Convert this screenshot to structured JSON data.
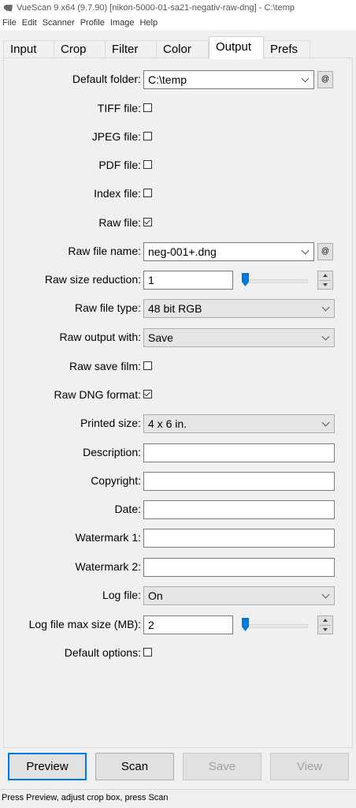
{
  "window": {
    "title": "VueScan 9 x64 (9.7.90) [nikon-5000-01-sa21-negativ-raw-dng] - C:\\temp"
  },
  "menu": [
    "File",
    "Edit",
    "Scanner",
    "Profile",
    "Image",
    "Help"
  ],
  "tabs": [
    {
      "label": "Input",
      "active": false
    },
    {
      "label": "Crop",
      "active": false
    },
    {
      "label": "Filter",
      "active": false
    },
    {
      "label": "Color",
      "active": false
    },
    {
      "label": "Output",
      "active": true
    },
    {
      "label": "Prefs",
      "active": false
    }
  ],
  "output": {
    "default_folder": {
      "label": "Default folder:",
      "value": "C:\\temp",
      "at": "@"
    },
    "tiff_file": {
      "label": "TIFF file:",
      "checked": false
    },
    "jpeg_file": {
      "label": "JPEG file:",
      "checked": false
    },
    "pdf_file": {
      "label": "PDF file:",
      "checked": false
    },
    "index_file": {
      "label": "Index file:",
      "checked": false
    },
    "raw_file": {
      "label": "Raw file:",
      "checked": true
    },
    "raw_file_name": {
      "label": "Raw file name:",
      "value": "neg-001+.dng",
      "at": "@"
    },
    "raw_size_reduction": {
      "label": "Raw size reduction:",
      "value": "1"
    },
    "raw_file_type": {
      "label": "Raw file type:",
      "value": "48 bit RGB"
    },
    "raw_output_with": {
      "label": "Raw output with:",
      "value": "Save"
    },
    "raw_save_film": {
      "label": "Raw save film:",
      "checked": false
    },
    "raw_dng_format": {
      "label": "Raw DNG format:",
      "checked": true
    },
    "printed_size": {
      "label": "Printed size:",
      "value": "4 x 6 in."
    },
    "description": {
      "label": "Description:",
      "value": ""
    },
    "copyright": {
      "label": "Copyright:",
      "value": ""
    },
    "date": {
      "label": "Date:",
      "value": ""
    },
    "watermark1": {
      "label": "Watermark 1:",
      "value": ""
    },
    "watermark2": {
      "label": "Watermark 2:",
      "value": ""
    },
    "log_file": {
      "label": "Log file:",
      "value": "On"
    },
    "log_file_max_size": {
      "label": "Log file max size (MB):",
      "value": "2"
    },
    "default_options": {
      "label": "Default options:",
      "checked": false
    }
  },
  "buttons": {
    "preview": "Preview",
    "scan": "Scan",
    "save": "Save",
    "view": "View"
  },
  "status": "Press Preview, adjust crop box, press Scan",
  "colors": {
    "accent": "#0078d7",
    "background": "#f0f0f0"
  }
}
